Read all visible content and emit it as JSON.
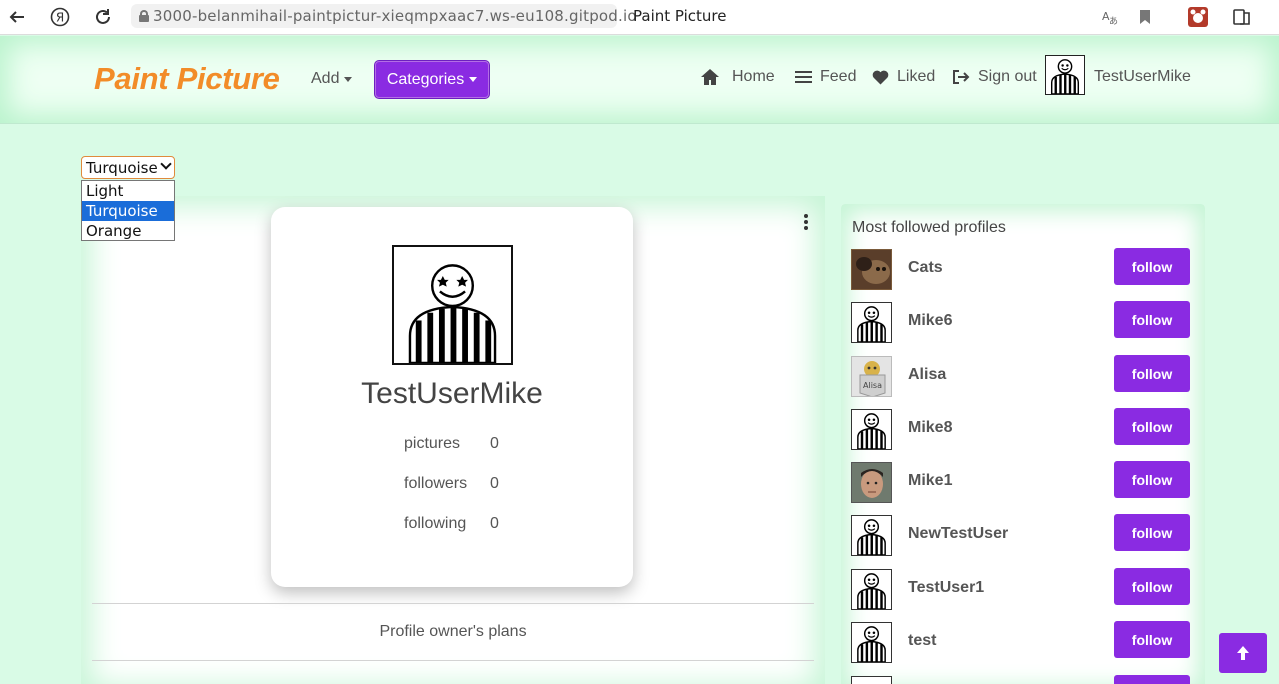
{
  "browser": {
    "url": "3000-belanmihail-paintpictur-xieqmpxaac7.ws-eu108.gitpod.io",
    "tab_title": "Paint Picture",
    "yandex_glyph": "Я"
  },
  "navbar": {
    "brand": "Paint Picture",
    "add_label": "Add",
    "categories_label": "Categories",
    "home_label": "Home",
    "feed_label": "Feed",
    "liked_label": "Liked",
    "signout_label": "Sign out",
    "username": "TestUserMike"
  },
  "theme": {
    "selected": "Turquoise",
    "options": [
      "Light",
      "Turquoise",
      "Orange"
    ]
  },
  "profile": {
    "name": "TestUserMike",
    "stats": [
      {
        "label": "pictures",
        "value": "0"
      },
      {
        "label": "followers",
        "value": "0"
      },
      {
        "label": "following",
        "value": "0"
      }
    ],
    "plans_label": "Profile owner's plans"
  },
  "sidebar": {
    "title": "Most followed profiles",
    "follow_label": "follow",
    "profiles": [
      {
        "name": "Cats",
        "avatar": "cat-photo"
      },
      {
        "name": "Mike6",
        "avatar": "smiley-striped"
      },
      {
        "name": "Alisa",
        "avatar": "alisa-badge"
      },
      {
        "name": "Mike8",
        "avatar": "smiley-striped"
      },
      {
        "name": "Mike1",
        "avatar": "face-photo"
      },
      {
        "name": "NewTestUser",
        "avatar": "smiley-striped"
      },
      {
        "name": "TestUser1",
        "avatar": "smiley-striped"
      },
      {
        "name": "test",
        "avatar": "smiley-striped"
      }
    ]
  },
  "colors": {
    "accent": "#8a2be2",
    "brand": "#f28c28",
    "background": "#d9fbe6"
  }
}
